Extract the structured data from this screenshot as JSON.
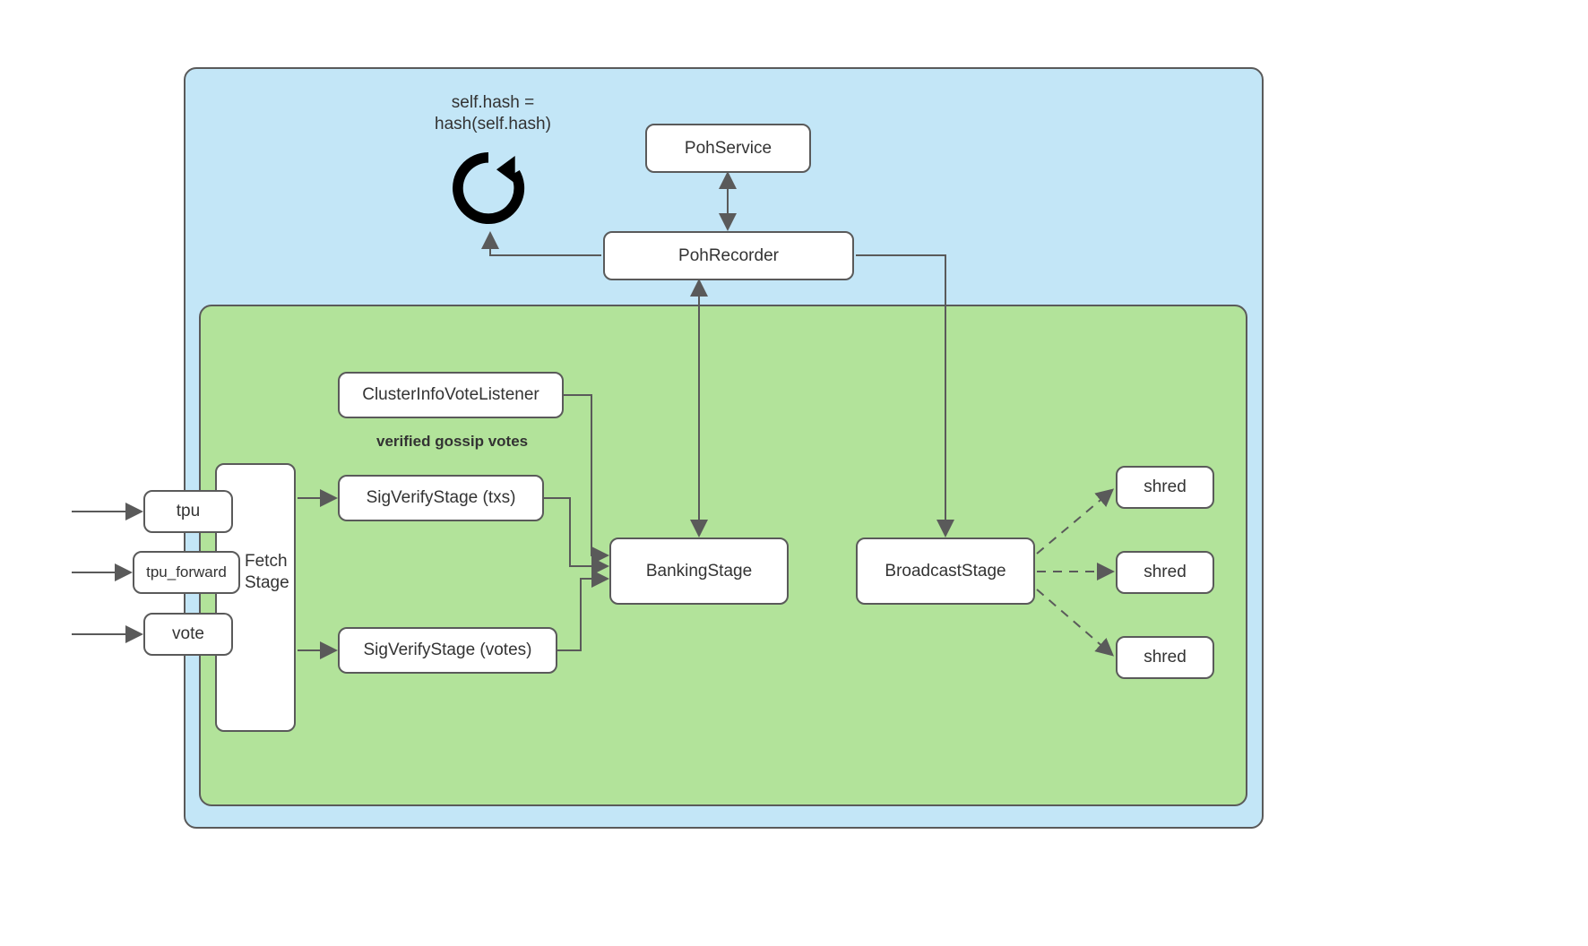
{
  "colors": {
    "outer_bg": "#c3e6f7",
    "inner_bg": "#b2e39a",
    "stroke": "#5a5a5a",
    "node_bg": "#ffffff"
  },
  "hash_label": "self.hash =\nhash(self.hash)",
  "poh_service": "PohService",
  "poh_recorder": "PohRecorder",
  "cluster_listener": "ClusterInfoVoteListener",
  "gossip_label": "verified gossip votes",
  "sigverify_txs": "SigVerifyStage (txs)",
  "sigverify_votes": "SigVerifyStage (votes)",
  "banking": "BankingStage",
  "broadcast": "BroadcastStage",
  "fetch_stage_label": "Fetch\nStage",
  "inputs": {
    "tpu": "tpu",
    "tpu_forward": "tpu_forward",
    "vote": "vote"
  },
  "shred": "shred"
}
